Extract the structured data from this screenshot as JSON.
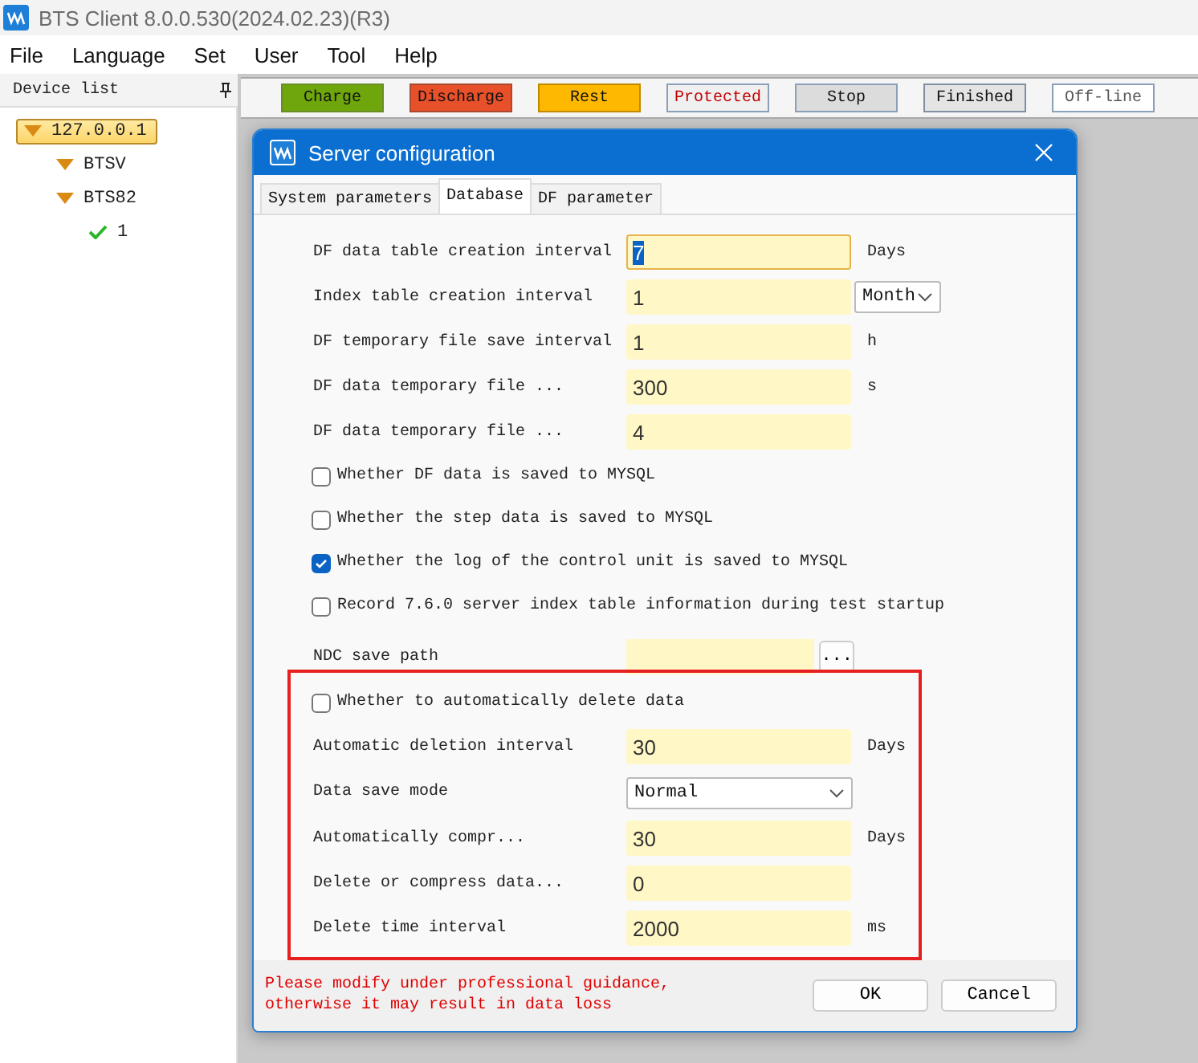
{
  "window": {
    "title": "BTS Client 8.0.0.530(2024.02.23)(R3)"
  },
  "menu": [
    "File",
    "Language",
    "Set",
    "User",
    "Tool",
    "Help"
  ],
  "device_list": {
    "title": "Device list",
    "tree": [
      {
        "label": "127.0.0.1",
        "kind": "group",
        "selected": true,
        "children": [
          {
            "label": "BTSV",
            "kind": "group",
            "selected": false
          },
          {
            "label": "BTS82",
            "kind": "group",
            "selected": false,
            "children": [
              {
                "label": "1",
                "kind": "channel",
                "selected": false
              }
            ]
          }
        ]
      }
    ]
  },
  "status_legend": [
    {
      "label": "Charge",
      "kind": "charge"
    },
    {
      "label": "Discharge",
      "kind": "discharge"
    },
    {
      "label": "Rest",
      "kind": "rest"
    },
    {
      "label": "Protected",
      "kind": "protected"
    },
    {
      "label": "Stop",
      "kind": "stop"
    },
    {
      "label": "Finished",
      "kind": "finished"
    },
    {
      "label": "Off-line",
      "kind": "offline"
    }
  ],
  "dialog": {
    "title": "Server configuration",
    "tabs": [
      {
        "label": "System parameters",
        "selected": false
      },
      {
        "label": "Database",
        "selected": true
      },
      {
        "label": "DF parameter",
        "selected": false
      }
    ],
    "settings": [
      {
        "kind": "text",
        "label": "DF data table creation interval",
        "value": "7",
        "unit": "Days",
        "focused": true
      },
      {
        "kind": "text-select",
        "label": "Index table creation interval",
        "value": "1",
        "unit": "Month"
      },
      {
        "kind": "text",
        "label": "DF temporary file save interval",
        "value": "1",
        "unit": "h",
        "focused": false
      },
      {
        "kind": "text",
        "label": "DF data temporary file ...",
        "value": "300",
        "unit": "s",
        "focused": false
      },
      {
        "kind": "text",
        "label": "DF data temporary file ...",
        "value": "4",
        "focused": false
      },
      {
        "kind": "checkbox",
        "label": "Whether DF data is saved to MYSQL",
        "checked": false
      },
      {
        "kind": "checkbox",
        "label": "Whether the step data is saved to MYSQL",
        "checked": false
      },
      {
        "kind": "checkbox",
        "label": "Whether the log of the control unit is saved to MYSQL",
        "checked": true
      },
      {
        "kind": "checkbox",
        "label": "Record 7.6.0 server index table information during test startup",
        "checked": false
      },
      {
        "kind": "path",
        "label": "NDC save path",
        "button": "..."
      }
    ],
    "highlighted_group": {
      "highlighted": true,
      "settings": [
        {
          "kind": "checkbox",
          "label": "Whether to automatically delete data",
          "checked": false
        },
        {
          "kind": "text",
          "label": "Automatic deletion interval",
          "value": "30",
          "unit": "Days",
          "focused": false
        },
        {
          "kind": "select",
          "label": "Data save mode",
          "value": "Normal"
        },
        {
          "kind": "text",
          "label": "Automatically compr...",
          "value": "30",
          "unit": "Days",
          "focused": false
        },
        {
          "kind": "text",
          "label": "Delete or compress data...",
          "value": "0",
          "focused": false
        },
        {
          "kind": "text",
          "label": "Delete time interval",
          "value": "2000",
          "unit": "ms",
          "focused": false
        }
      ]
    },
    "warning": [
      "Please modify under professional guidance,",
      "otherwise it may result in data loss"
    ],
    "buttons": [
      "OK",
      "Cancel"
    ]
  }
}
